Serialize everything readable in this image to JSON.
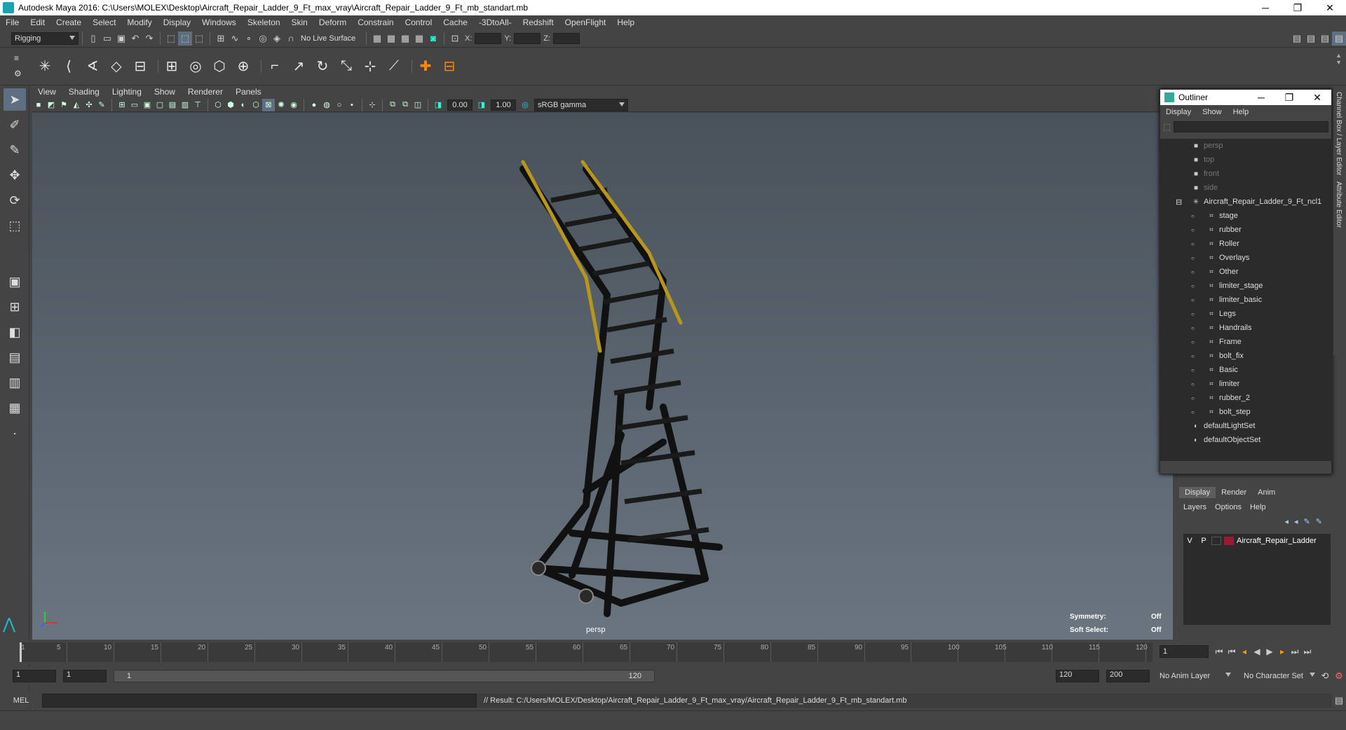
{
  "window": {
    "title": "Autodesk Maya 2016: C:\\Users\\MOLEX\\Desktop\\Aircraft_Repair_Ladder_9_Ft_max_vray\\Aircraft_Repair_Ladder_9_Ft_mb_standart.mb",
    "minimize": "─",
    "maximize": "❐",
    "close": "✕"
  },
  "menubar": [
    "File",
    "Edit",
    "Create",
    "Select",
    "Modify",
    "Display",
    "Windows",
    "Skeleton",
    "Skin",
    "Deform",
    "Constrain",
    "Control",
    "Cache",
    "-3DtoAll-",
    "Redshift",
    "OpenFlight",
    "Help"
  ],
  "statusline": {
    "mode": "Rigging",
    "live_surface": "No Live Surface",
    "x_label": "X:",
    "y_label": "Y:",
    "z_label": "Z:"
  },
  "panel": {
    "menu": [
      "View",
      "Shading",
      "Lighting",
      "Show",
      "Renderer",
      "Panels"
    ],
    "exposure": "0.00",
    "gamma": "1.00",
    "colorspace": "sRGB gamma",
    "camera": "persp",
    "symmetry_label": "Symmetry:",
    "symmetry_value": "Off",
    "soft_select_label": "Soft Select:",
    "soft_select_value": "Off"
  },
  "outliner": {
    "title": "Outliner",
    "menu": [
      "Display",
      "Show",
      "Help"
    ],
    "items": [
      {
        "label": "persp",
        "type": "camera",
        "dim": true
      },
      {
        "label": "top",
        "type": "camera",
        "dim": true
      },
      {
        "label": "front",
        "type": "camera",
        "dim": true
      },
      {
        "label": "side",
        "type": "camera",
        "dim": true
      },
      {
        "label": "Aircraft_Repair_Ladder_9_Ft_ncl1",
        "type": "group",
        "dim": false
      },
      {
        "label": "stage",
        "type": "mesh",
        "dim": false
      },
      {
        "label": "rubber",
        "type": "mesh",
        "dim": false
      },
      {
        "label": "Roller",
        "type": "mesh",
        "dim": false
      },
      {
        "label": "Overlays",
        "type": "mesh",
        "dim": false
      },
      {
        "label": "Other",
        "type": "mesh",
        "dim": false
      },
      {
        "label": "limiter_stage",
        "type": "mesh",
        "dim": false
      },
      {
        "label": "limiter_basic",
        "type": "mesh",
        "dim": false
      },
      {
        "label": "Legs",
        "type": "mesh",
        "dim": false
      },
      {
        "label": "Handrails",
        "type": "mesh",
        "dim": false
      },
      {
        "label": "Frame",
        "type": "mesh",
        "dim": false
      },
      {
        "label": "bolt_fix",
        "type": "mesh",
        "dim": false
      },
      {
        "label": "Basic",
        "type": "mesh",
        "dim": false
      },
      {
        "label": "limiter",
        "type": "mesh",
        "dim": false
      },
      {
        "label": "rubber_2",
        "type": "mesh",
        "dim": false
      },
      {
        "label": "bolt_step",
        "type": "mesh",
        "dim": false
      },
      {
        "label": "defaultLightSet",
        "type": "set",
        "dim": false
      },
      {
        "label": "defaultObjectSet",
        "type": "set",
        "dim": false
      }
    ]
  },
  "side_tabs": [
    "Channel Box / Layer Editor",
    "Attribute Editor"
  ],
  "layers": {
    "tabs": [
      "Display",
      "Render",
      "Anim"
    ],
    "menu": [
      "Layers",
      "Options",
      "Help"
    ],
    "rows": [
      {
        "v": "V",
        "p": "P",
        "name": "Aircraft_Repair_Ladder",
        "color": "#9b1a33"
      }
    ]
  },
  "timeline": {
    "ticks": [
      "5",
      "10",
      "15",
      "20",
      "25",
      "30",
      "35",
      "40",
      "45",
      "50",
      "55",
      "60",
      "65",
      "70",
      "75",
      "80",
      "85",
      "90",
      "95",
      "100",
      "105",
      "110",
      "115",
      "120"
    ],
    "first": "1",
    "current_frame": "1"
  },
  "range": {
    "start": "1",
    "start2": "1",
    "range_start": "1",
    "range_end": "120",
    "end": "120",
    "end2": "200",
    "anim_layer": "No Anim Layer",
    "character_set": "No Character Set"
  },
  "command": {
    "lang": "MEL",
    "result": "// Result: C:/Users/MOLEX/Desktop/Aircraft_Repair_Ladder_9_Ft_max_vray/Aircraft_Repair_Ladder_9_Ft_mb_standart.mb"
  }
}
